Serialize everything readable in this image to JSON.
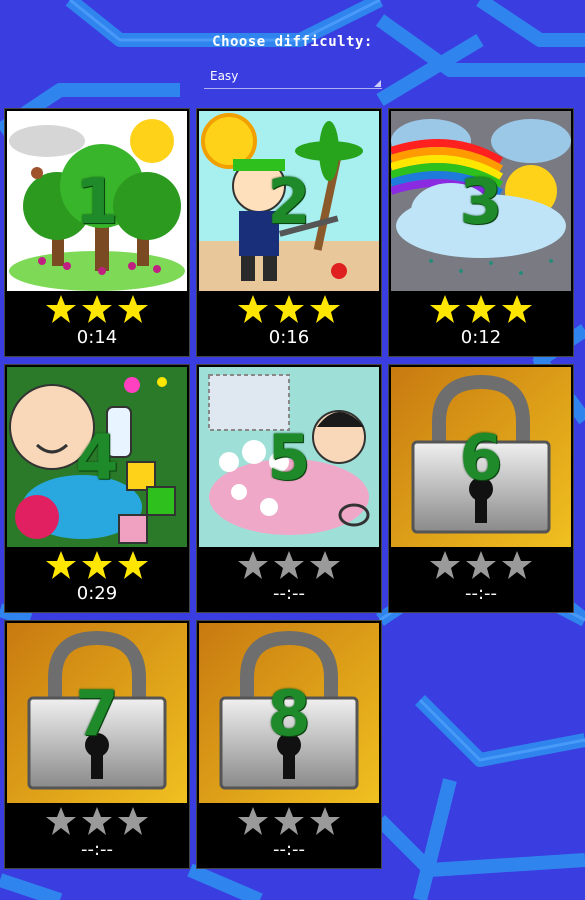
{
  "header": {
    "title": "Choose difficulty:",
    "difficulty": "Easy"
  },
  "levels": [
    {
      "number": "1",
      "stars_earned": 3,
      "time": "0:14",
      "locked": false,
      "theme": "trees-icon"
    },
    {
      "number": "2",
      "stars_earned": 3,
      "time": "0:16",
      "locked": false,
      "theme": "pirate-icon"
    },
    {
      "number": "3",
      "stars_earned": 3,
      "time": "0:12",
      "locked": false,
      "theme": "rainbow-icon"
    },
    {
      "number": "4",
      "stars_earned": 3,
      "time": "0:29",
      "locked": false,
      "theme": "baby-icon"
    },
    {
      "number": "5",
      "stars_earned": 0,
      "time": "--:--",
      "locked": false,
      "theme": "bath-icon"
    },
    {
      "number": "6",
      "stars_earned": 0,
      "time": "--:--",
      "locked": true,
      "theme": "padlock-icon"
    },
    {
      "number": "7",
      "stars_earned": 0,
      "time": "--:--",
      "locked": true,
      "theme": "padlock-icon"
    },
    {
      "number": "8",
      "stars_earned": 0,
      "time": "--:--",
      "locked": true,
      "theme": "padlock-icon"
    }
  ],
  "colors": {
    "background": "#3a3de0",
    "hex_lines": "#2f8cf0",
    "star_earned": "#ffe600",
    "star_empty": "#9a9a9a",
    "level_number": "#1f8a2a"
  }
}
